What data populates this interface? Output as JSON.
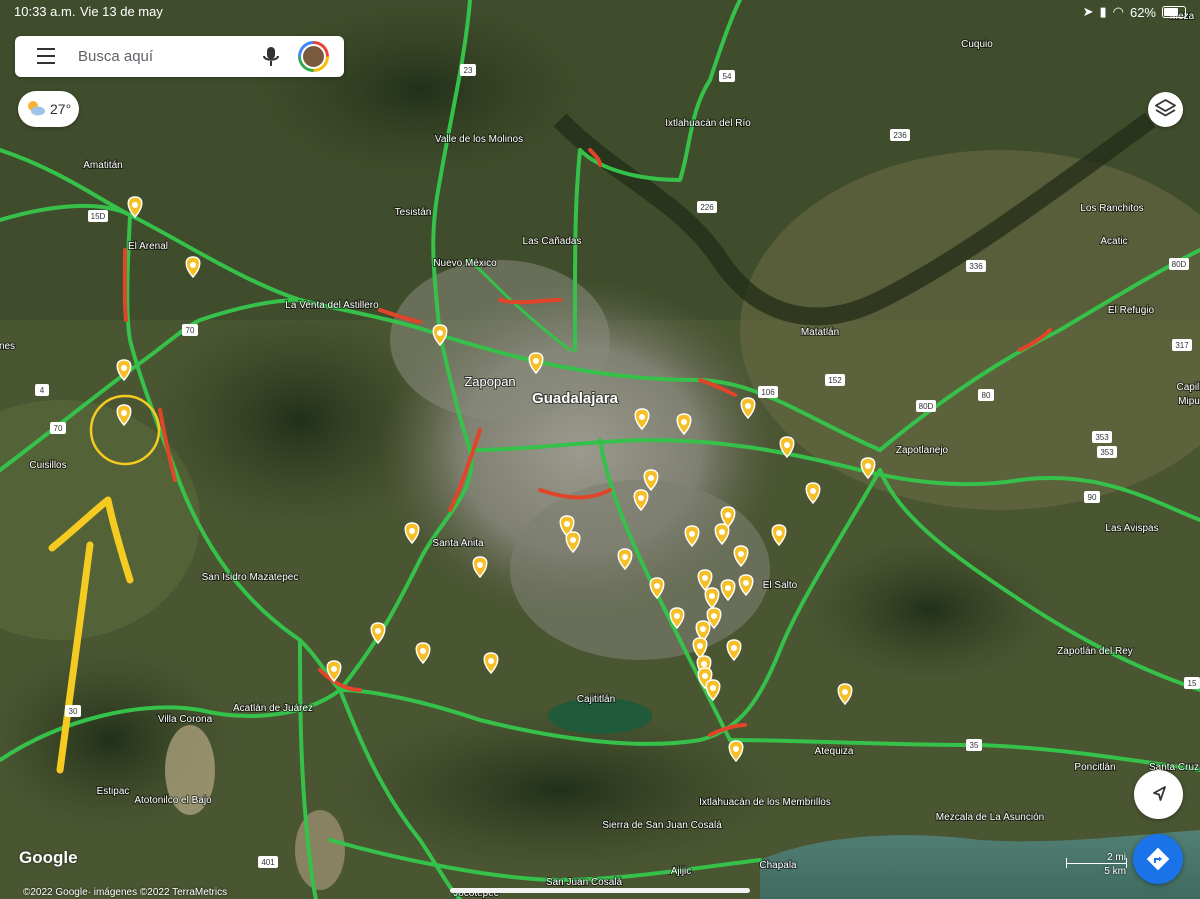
{
  "status_bar": {
    "time": "10:33 a.m.",
    "date": "Vie 13 de may",
    "battery": "62%",
    "battery_level": 0.62
  },
  "search": {
    "placeholder": "Busca aquí"
  },
  "weather": {
    "temperature": "27°",
    "icon": "partly-cloudy-icon"
  },
  "brand": {
    "logo": "Google",
    "attribution": "©2022 Google· imágenes ©2022 TerraMetrics"
  },
  "scale": {
    "miles": "2 mi",
    "km": "5 km"
  },
  "colors": {
    "traffic_fast": "#35c14a",
    "traffic_slow": "#e0452a",
    "marker": "#f6bf26",
    "annotation": "#f5cb22",
    "directions": "#1a73e8",
    "lake": "#1f5a3a",
    "water": "#4f7f72"
  },
  "map": {
    "place_labels": [
      "Cuquio",
      "Amatitán",
      "Valle de los Molinos",
      "Ixtlahuacán del Río",
      "Tesistán",
      "El Arenal",
      "Las Cañadas",
      "Los Ranchitos",
      "Acatic",
      "Nuevo México",
      "La Venta del Astillero",
      "El Refugio",
      "Matatlán",
      "Zapopan",
      "Guadalajara",
      "Zapotlanejo",
      "Capill",
      "Mipu",
      "Cuisillos",
      "Santa Anita",
      "Las Avispas",
      "San Isidro Mazatepec",
      "El Salto",
      "Zapotlán del Rey",
      "Cajititlán",
      "Villa Corona",
      "Acatlán de Juárez",
      "Atequiza",
      "Poncitlán",
      "Santa Cruz",
      "Estipac",
      "Atotonilco el Bajo",
      "Ixtlahuacán de los Membrillos",
      "Sierra de San Juan Cosalá",
      "Mezcala de La Asunción",
      "Chapala",
      "Ajijic",
      "San Juan Cosalá",
      "Jocotepec",
      "Meza",
      "nes"
    ],
    "route_shields": [
      "23",
      "54",
      "15D",
      "236",
      "226",
      "70",
      "4",
      "70",
      "336",
      "80D",
      "317",
      "152",
      "106",
      "80D",
      "80",
      "353",
      "353",
      "90",
      "35",
      "15",
      "30",
      "401"
    ]
  }
}
